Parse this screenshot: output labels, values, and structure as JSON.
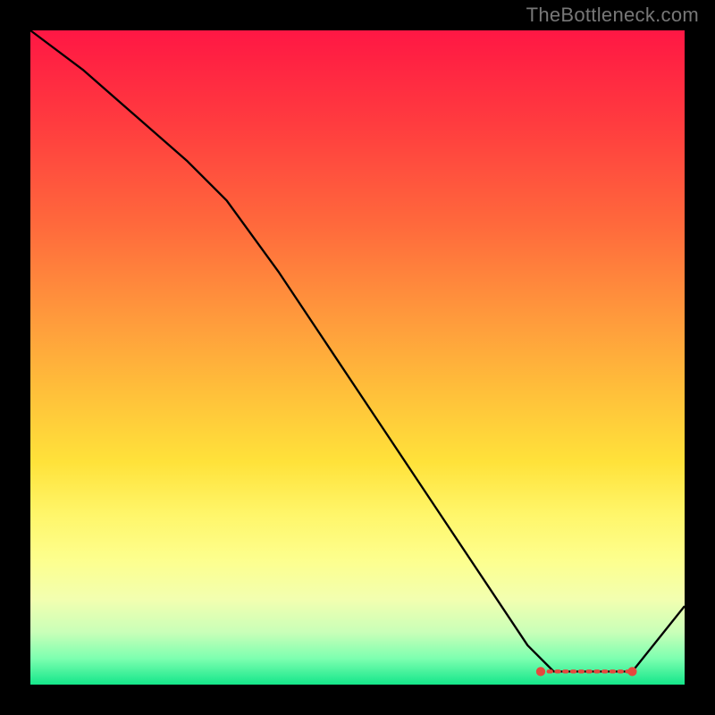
{
  "watermark": "TheBottleneck.com",
  "colors": {
    "line": "#000000",
    "marker": "#e5493d",
    "gradient_top": "#ff1744",
    "gradient_bottom": "#14e68a"
  },
  "chart_data": {
    "type": "line",
    "title": "",
    "xlabel": "",
    "ylabel": "",
    "xlim": [
      0,
      100
    ],
    "ylim": [
      0,
      100
    ],
    "x": [
      0,
      8,
      16,
      24,
      30,
      38,
      46,
      54,
      62,
      70,
      76,
      80,
      84,
      88,
      92,
      100
    ],
    "y": [
      100,
      94,
      87,
      80,
      74,
      63,
      51,
      39,
      27,
      15,
      6,
      2,
      2,
      2,
      2,
      12
    ],
    "flat_segment": {
      "x_start": 78,
      "x_end": 92,
      "y": 2
    },
    "note": "y read as percentage height; values estimated from pixels (no axis labels in source)."
  }
}
